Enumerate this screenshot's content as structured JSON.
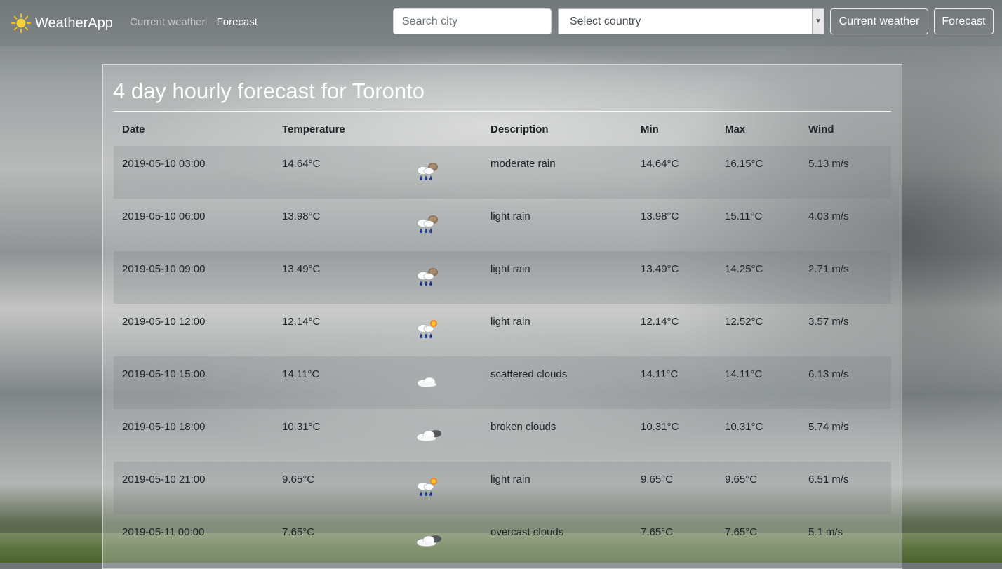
{
  "navbar": {
    "brand": "WeatherApp",
    "links": [
      {
        "label": "Current weather",
        "active": false
      },
      {
        "label": "Forecast",
        "active": true
      }
    ],
    "search_placeholder": "Search city",
    "country_select": "Select country",
    "current_button": "Current weather",
    "forecast_button": "Forecast"
  },
  "forecast": {
    "title": "4 day hourly forecast for Toronto",
    "headers": {
      "date": "Date",
      "temperature": "Temperature",
      "description": "Description",
      "min": "Min",
      "max": "Max",
      "wind": "Wind"
    },
    "rows": [
      {
        "date": "2019-05-10 03:00",
        "temp": "14.64°C",
        "icon": "rain-cloudy-icon",
        "description": "moderate rain",
        "min": "14.64°C",
        "max": "16.15°C",
        "wind": "5.13 m/s"
      },
      {
        "date": "2019-05-10 06:00",
        "temp": "13.98°C",
        "icon": "rain-cloudy-icon",
        "description": "light rain",
        "min": "13.98°C",
        "max": "15.11°C",
        "wind": "4.03 m/s"
      },
      {
        "date": "2019-05-10 09:00",
        "temp": "13.49°C",
        "icon": "rain-cloudy-icon",
        "description": "light rain",
        "min": "13.49°C",
        "max": "14.25°C",
        "wind": "2.71 m/s"
      },
      {
        "date": "2019-05-10 12:00",
        "temp": "12.14°C",
        "icon": "rain-sun-icon",
        "description": "light rain",
        "min": "12.14°C",
        "max": "12.52°C",
        "wind": "3.57 m/s"
      },
      {
        "date": "2019-05-10 15:00",
        "temp": "14.11°C",
        "icon": "cloud-icon",
        "description": "scattered clouds",
        "min": "14.11°C",
        "max": "14.11°C",
        "wind": "6.13 m/s"
      },
      {
        "date": "2019-05-10 18:00",
        "temp": "10.31°C",
        "icon": "broken-clouds-icon",
        "description": "broken clouds",
        "min": "10.31°C",
        "max": "10.31°C",
        "wind": "5.74 m/s"
      },
      {
        "date": "2019-05-10 21:00",
        "temp": "9.65°C",
        "icon": "rain-sun-icon",
        "description": "light rain",
        "min": "9.65°C",
        "max": "9.65°C",
        "wind": "6.51 m/s"
      },
      {
        "date": "2019-05-11 00:00",
        "temp": "7.65°C",
        "icon": "broken-clouds-icon",
        "description": "overcast clouds",
        "min": "7.65°C",
        "max": "7.65°C",
        "wind": "5.1 m/s"
      }
    ]
  }
}
